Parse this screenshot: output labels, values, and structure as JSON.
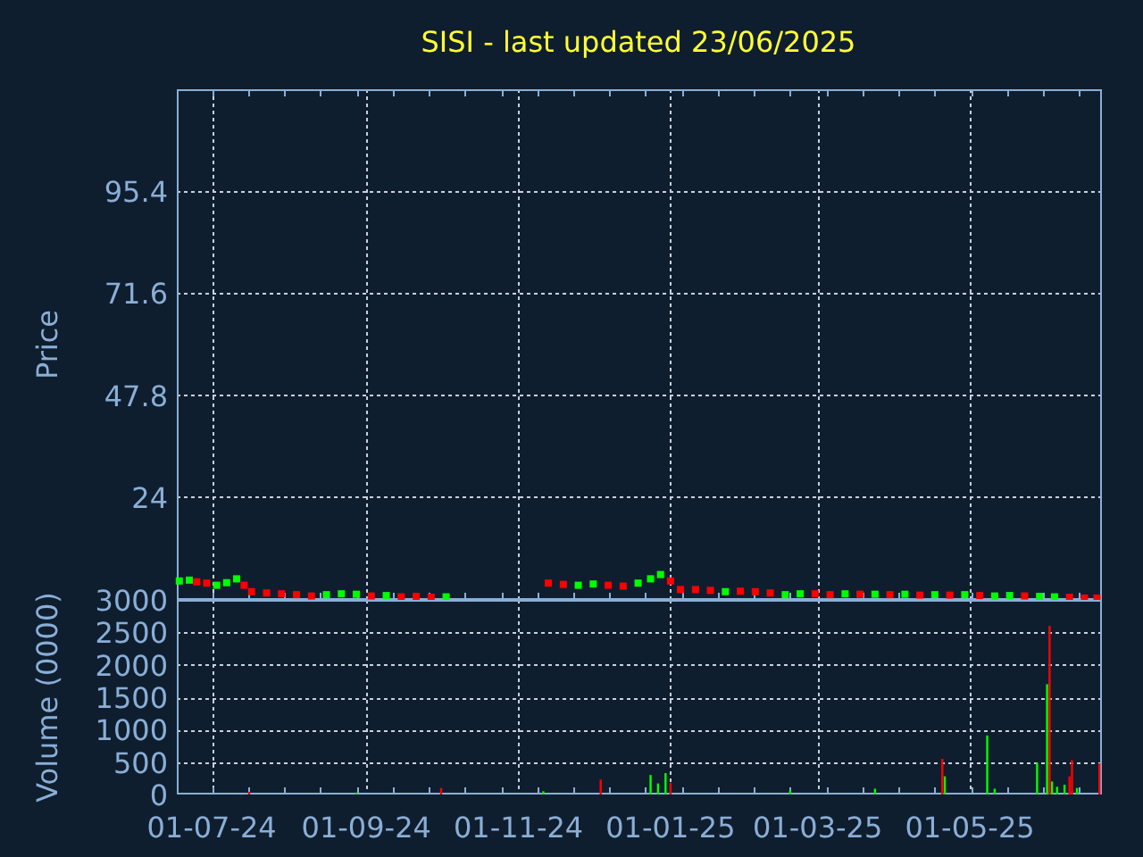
{
  "title": "SISI - last updated 23/06/2025",
  "price_chart": {
    "chart_data": {
      "type": "scatter",
      "grid": true,
      "ylabel": "Price",
      "xlim": [
        "2024-06-17",
        "2025-06-23"
      ],
      "ylim": [
        0,
        119.2
      ],
      "yticks": [
        {
          "value": 24,
          "label": "24"
        },
        {
          "value": 47.8,
          "label": "47.8"
        },
        {
          "value": 71.6,
          "label": "71.6"
        },
        {
          "value": 95.4,
          "label": "95.4"
        }
      ],
      "x": [
        "2024-06-18",
        "2024-06-22",
        "2024-06-25",
        "2024-06-29",
        "2024-07-03",
        "2024-07-07",
        "2024-07-11",
        "2024-07-14",
        "2024-07-17",
        "2024-07-23",
        "2024-07-29",
        "2024-08-04",
        "2024-08-10",
        "2024-08-16",
        "2024-08-22",
        "2024-08-28",
        "2024-09-03",
        "2024-09-09",
        "2024-09-15",
        "2024-09-21",
        "2024-09-27",
        "2024-10-03",
        "2024-11-13",
        "2024-11-19",
        "2024-11-25",
        "2024-12-01",
        "2024-12-07",
        "2024-12-13",
        "2024-12-19",
        "2024-12-24",
        "2024-12-28",
        "2025-01-01",
        "2025-01-05",
        "2025-01-11",
        "2025-01-17",
        "2025-01-23",
        "2025-01-29",
        "2025-02-04",
        "2025-02-10",
        "2025-02-16",
        "2025-02-22",
        "2025-02-28",
        "2025-03-06",
        "2025-03-12",
        "2025-03-18",
        "2025-03-24",
        "2025-03-30",
        "2025-04-05",
        "2025-04-11",
        "2025-04-17",
        "2025-04-23",
        "2025-04-29",
        "2025-05-05",
        "2025-05-11",
        "2025-05-17",
        "2025-05-23",
        "2025-05-29",
        "2025-06-04",
        "2025-06-10",
        "2025-06-16",
        "2025-06-21"
      ],
      "series": [
        {
          "color": "#00ff00",
          "values": [
            4.0,
            4.2,
            null,
            null,
            3.0,
            3.6,
            4.5,
            null,
            null,
            null,
            null,
            null,
            null,
            0.8,
            1.0,
            0.9,
            null,
            0.6,
            null,
            null,
            null,
            0.3,
            null,
            null,
            3.0,
            3.3,
            null,
            null,
            3.5,
            4.5,
            5.5,
            null,
            null,
            null,
            null,
            1.5,
            null,
            null,
            null,
            0.8,
            1.0,
            null,
            null,
            1.0,
            null,
            0.9,
            null,
            0.9,
            null,
            0.8,
            null,
            0.8,
            null,
            0.5,
            0.6,
            null,
            0.4,
            0.3,
            null,
            null,
            null
          ]
        },
        {
          "color": "#ff0000",
          "values": [
            null,
            null,
            3.8,
            3.5,
            null,
            null,
            null,
            3.0,
            1.5,
            1.2,
            1.0,
            0.8,
            0.5,
            null,
            null,
            null,
            0.5,
            null,
            0.3,
            0.4,
            0.2,
            null,
            3.5,
            3.2,
            null,
            null,
            3.0,
            2.8,
            null,
            null,
            null,
            4.0,
            2.0,
            2.0,
            1.8,
            null,
            1.6,
            1.5,
            1.2,
            null,
            null,
            1.0,
            0.8,
            null,
            0.9,
            null,
            0.8,
            null,
            0.7,
            null,
            0.7,
            null,
            0.6,
            null,
            null,
            0.5,
            null,
            null,
            0.2,
            0.0,
            0.0
          ]
        }
      ]
    }
  },
  "volume_chart": {
    "chart_data": {
      "type": "bar",
      "grid": true,
      "ylabel": "Volume (0000)",
      "xlim": [
        "2024-06-17",
        "2025-06-23"
      ],
      "ylim": [
        0,
        3000
      ],
      "yticks": [
        0,
        500,
        1000,
        1500,
        2000,
        2500,
        3000
      ],
      "xticks": [
        {
          "value": "2024-07-01",
          "label": "01-07-24"
        },
        {
          "value": "2024-09-01",
          "label": "01-09-24"
        },
        {
          "value": "2024-11-01",
          "label": "01-11-24"
        },
        {
          "value": "2025-01-01",
          "label": "01-01-25"
        },
        {
          "value": "2025-03-01",
          "label": "01-03-25"
        },
        {
          "value": "2025-05-01",
          "label": "01-05-25"
        }
      ],
      "x": [
        "2024-07-16",
        "2024-08-28",
        "2024-10-01",
        "2024-11-11",
        "2024-12-04",
        "2024-12-24",
        "2024-12-27",
        "2024-12-30",
        "2025-01-01",
        "2025-02-18",
        "2025-03-24",
        "2025-04-20",
        "2025-04-21",
        "2025-05-08",
        "2025-05-11",
        "2025-05-28",
        "2025-06-01",
        "2025-06-02",
        "2025-06-03",
        "2025-06-05",
        "2025-06-08",
        "2025-06-10",
        "2025-06-11",
        "2025-06-13",
        "2025-06-22"
      ],
      "series": [
        {
          "color": "#00ff00",
          "values": [
            null,
            30,
            null,
            50,
            null,
            300,
            170,
            330,
            null,
            60,
            90,
            null,
            280,
            910,
            90,
            490,
            1700,
            null,
            200,
            120,
            150,
            null,
            null,
            100,
            null
          ]
        },
        {
          "color": "#ff0000",
          "values": [
            40,
            null,
            100,
            null,
            230,
            null,
            null,
            null,
            180,
            null,
            null,
            550,
            null,
            null,
            null,
            null,
            null,
            2600,
            null,
            null,
            null,
            280,
            530,
            null,
            480
          ]
        }
      ]
    }
  }
}
